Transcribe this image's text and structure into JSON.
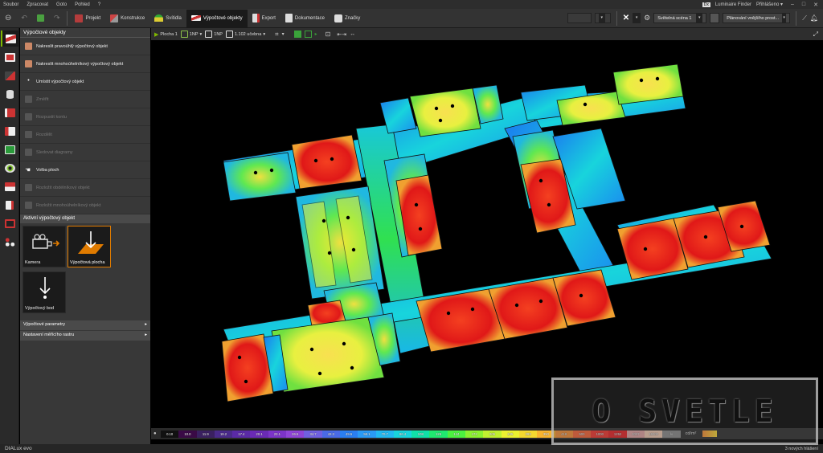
{
  "menubar": {
    "items": [
      "Soubor",
      "Zpracovat",
      "Goto",
      "Pohled",
      "?"
    ],
    "luminaire_finder": "Luminaire Finder",
    "login": "Přihlášeno ▾"
  },
  "toolbar": {
    "tabs": [
      {
        "label": "Projekt"
      },
      {
        "label": "Konstrukce"
      },
      {
        "label": "Svítidla"
      },
      {
        "label": "Výpočtové objekty"
      },
      {
        "label": "Export"
      },
      {
        "label": "Dokumentace"
      },
      {
        "label": "Značky"
      }
    ],
    "scene_select": "Světelná scéna 1",
    "planning_select": "Plánování vnějšího prost..."
  },
  "panel": {
    "title": "Výpočtové objekty",
    "tools": [
      {
        "label": "Nakreslit pravoúhlý výpočtový objekt",
        "enabled": true
      },
      {
        "label": "Nakreslit mnohoúhelníkový výpočtový objekt",
        "enabled": true
      },
      {
        "label": "Umístit výpočtový objekt",
        "enabled": true
      },
      {
        "label": "Změřit",
        "enabled": false
      },
      {
        "label": "Rozpustit kontu",
        "enabled": false
      },
      {
        "label": "Rozdělit",
        "enabled": false
      },
      {
        "label": "Sledovat diagramy",
        "enabled": false
      },
      {
        "label": "Volba ploch",
        "enabled": true
      },
      {
        "label": "Rozložit obdélníkový objekt",
        "enabled": false
      },
      {
        "label": "Rozložit mnohoúhelníkový objekt",
        "enabled": false
      }
    ],
    "active_section": "Aktivní výpočtový objekt",
    "tiles": [
      {
        "label": "Kamera"
      },
      {
        "label": "Výpočtová plocha"
      },
      {
        "label": "Výpočtový bod"
      }
    ],
    "collapsed": [
      "Výpočtové parametry",
      "Nastavení měřícího rastru"
    ]
  },
  "view_toolbar": {
    "surface": "Plocha 1",
    "floor1": "1NP",
    "floor2": "1NP",
    "level": "1.102 učebna"
  },
  "scale": {
    "values": [
      "0.10",
      "10.0",
      "11.9",
      "19.2",
      "17.4",
      "20.1",
      "23.1",
      "26.5",
      "34.7",
      "42.3",
      "49.5",
      "58.1",
      "70.7",
      "86.4",
      "108",
      "125",
      "144",
      "172",
      "205",
      "245",
      "293",
      "350",
      "418",
      "500",
      "1000",
      "1252",
      "4027",
      "15000",
      "lx"
    ],
    "colors": [
      "#111111",
      "#3a0a46",
      "#3a2060",
      "#4a2a8a",
      "#5a2aa6",
      "#6a2ab6",
      "#7c34c8",
      "#8f44d6",
      "#7060e0",
      "#4a6ae6",
      "#2a7ef0",
      "#2a9af4",
      "#22b8f0",
      "#18d4dc",
      "#10e0a8",
      "#20e870",
      "#4cf040",
      "#8cf030",
      "#c0f030",
      "#ecf030",
      "#f4d830",
      "#f8b430",
      "#f88c30",
      "#f86030",
      "#f43028",
      "#e81c20",
      "#e0a0a0",
      "#f0c8b0",
      "#888888"
    ],
    "unit": "cd/m²"
  },
  "status": {
    "brand": "DIALux evo",
    "message": "3 nových hlášení"
  },
  "watermark": "O SVETLE",
  "colors": {
    "accent_green": "#7fb700",
    "selection_orange": "#e07b00"
  }
}
